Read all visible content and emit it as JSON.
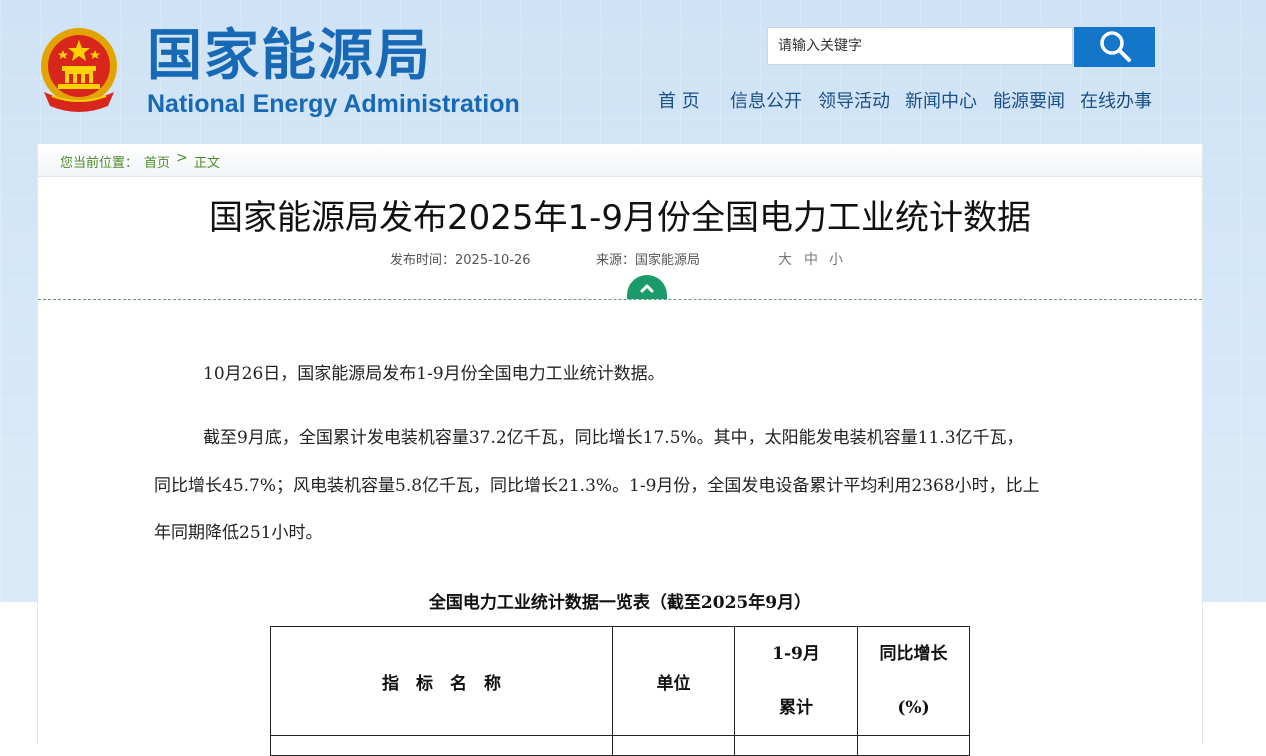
{
  "header": {
    "site_name_cn": "国家能源局",
    "site_name_en": "National Energy Administration",
    "search_placeholder": "请输入关键字",
    "nav": [
      "首 页",
      "信息公开",
      "领导活动",
      "新闻中心",
      "能源要闻",
      "在线办事"
    ]
  },
  "breadcrumb": {
    "prefix": "您当前位置：",
    "home": "首页",
    "separator": ">",
    "current": "正文"
  },
  "article": {
    "title": "国家能源局发布2025年1-9月份全国电力工业统计数据",
    "publish_time_label": "发布时间：2025-10-26",
    "source_label": "来源：国家能源局",
    "font_sizes": [
      "大",
      "中",
      "小"
    ],
    "paragraphs": [
      "10月26日，国家能源局发布1-9月份全国电力工业统计数据。",
      "截至9月底，全国累计发电装机容量37.2亿千瓦，同比增长17.5%。其中，太阳能发电装机容量11.3亿千瓦，",
      "同比增长45.7%；风电装机容量5.8亿千瓦，同比增长21.3%。1-9月份，全国发电设备累计平均利用2368小时，比上",
      "年同期降低251小时。"
    ]
  },
  "table": {
    "caption": "全国电力工业统计数据一览表（截至2025年9月）",
    "headers": {
      "name": "指　标　名　称",
      "unit": "单位",
      "cumulative_line1": "1-9月",
      "cumulative_line2": "累计",
      "growth_line1": "同比增长",
      "growth_line2": "(%)"
    }
  },
  "colors": {
    "brand_blue": "#1769b5",
    "search_button": "#1476c8",
    "breadcrumb_green": "#4e8a2a",
    "collapse_green": "#1b9a6c"
  }
}
